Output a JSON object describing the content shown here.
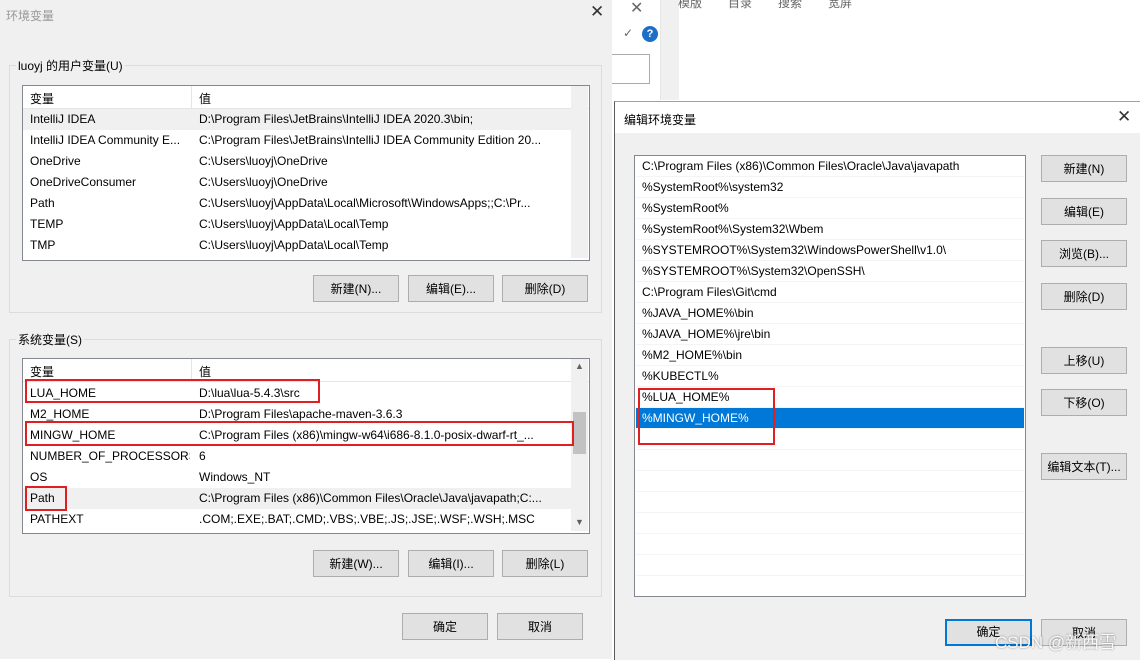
{
  "background_app": {
    "tabs": [
      "模版",
      "目录",
      "搜索",
      "宽屏"
    ]
  },
  "env_dialog": {
    "title": "环境变量",
    "user_group_label": "luoyj 的用户变量(U)",
    "system_group_label": "系统变量(S)",
    "col_var": "变量",
    "col_value": "值",
    "user_vars": [
      {
        "name": "IntelliJ IDEA",
        "value": "D:\\Program Files\\JetBrains\\IntelliJ IDEA 2020.3\\bin;"
      },
      {
        "name": "IntelliJ IDEA Community E...",
        "value": "C:\\Program Files\\JetBrains\\IntelliJ IDEA Community Edition 20..."
      },
      {
        "name": "OneDrive",
        "value": "C:\\Users\\luoyj\\OneDrive"
      },
      {
        "name": "OneDriveConsumer",
        "value": "C:\\Users\\luoyj\\OneDrive"
      },
      {
        "name": "Path",
        "value": "C:\\Users\\luoyj\\AppData\\Local\\Microsoft\\WindowsApps;;C:\\Pr..."
      },
      {
        "name": "TEMP",
        "value": "C:\\Users\\luoyj\\AppData\\Local\\Temp"
      },
      {
        "name": "TMP",
        "value": "C:\\Users\\luoyj\\AppData\\Local\\Temp"
      }
    ],
    "system_vars": [
      {
        "name": "LUA_HOME",
        "value": "D:\\lua\\lua-5.4.3\\src"
      },
      {
        "name": "M2_HOME",
        "value": "D:\\Program Files\\apache-maven-3.6.3"
      },
      {
        "name": "MINGW_HOME",
        "value": "C:\\Program Files (x86)\\mingw-w64\\i686-8.1.0-posix-dwarf-rt_..."
      },
      {
        "name": "NUMBER_OF_PROCESSORS",
        "value": "6"
      },
      {
        "name": "OS",
        "value": "Windows_NT"
      },
      {
        "name": "Path",
        "value": "C:\\Program Files (x86)\\Common Files\\Oracle\\Java\\javapath;C:..."
      },
      {
        "name": "PATHEXT",
        "value": ".COM;.EXE;.BAT;.CMD;.VBS;.VBE;.JS;.JSE;.WSF;.WSH;.MSC"
      }
    ],
    "user_buttons": {
      "new": "新建(N)...",
      "edit": "编辑(E)...",
      "delete": "删除(D)"
    },
    "system_buttons": {
      "new": "新建(W)...",
      "edit": "编辑(I)...",
      "delete": "删除(L)"
    },
    "ok": "确定",
    "cancel": "取消"
  },
  "edit_dialog": {
    "title": "编辑环境变量",
    "entries": [
      "C:\\Program Files (x86)\\Common Files\\Oracle\\Java\\javapath",
      "%SystemRoot%\\system32",
      "%SystemRoot%",
      "%SystemRoot%\\System32\\Wbem",
      "%SYSTEMROOT%\\System32\\WindowsPowerShell\\v1.0\\",
      "%SYSTEMROOT%\\System32\\OpenSSH\\",
      "C:\\Program Files\\Git\\cmd",
      "%JAVA_HOME%\\bin",
      "%JAVA_HOME%\\jre\\bin",
      "%M2_HOME%\\bin",
      "%KUBECTL%",
      "%LUA_HOME%",
      "%MINGW_HOME%"
    ],
    "selected_entry": "%MINGW_HOME%",
    "buttons": {
      "new": "新建(N)",
      "edit": "编辑(E)",
      "browse": "浏览(B)...",
      "delete": "删除(D)",
      "move_up": "上移(U)",
      "move_down": "下移(O)",
      "edit_text": "编辑文本(T)..."
    },
    "ok": "确定",
    "cancel": "取消"
  },
  "watermark": "CSDN @新西雪",
  "colors": {
    "selection": "#0078d7",
    "highlight_box": "#e02020",
    "dialog_bg": "#f0f0f0"
  }
}
